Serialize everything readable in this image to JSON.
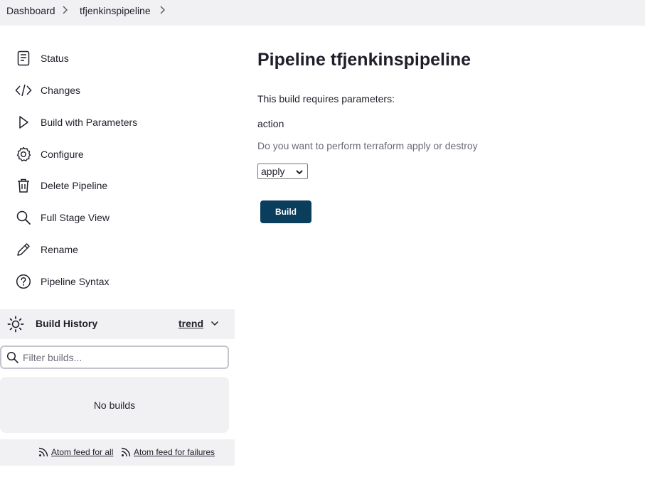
{
  "breadcrumb": {
    "items": [
      {
        "label": "Dashboard"
      },
      {
        "label": "tfjenkinspipeline"
      }
    ]
  },
  "sidebar": {
    "items": [
      {
        "label": "Status",
        "icon": "document-icon"
      },
      {
        "label": "Changes",
        "icon": "code-icon"
      },
      {
        "label": "Build with Parameters",
        "icon": "play-icon"
      },
      {
        "label": "Configure",
        "icon": "gear-icon"
      },
      {
        "label": "Delete Pipeline",
        "icon": "trash-icon"
      },
      {
        "label": "Full Stage View",
        "icon": "search-icon"
      },
      {
        "label": "Rename",
        "icon": "pencil-icon"
      },
      {
        "label": "Pipeline Syntax",
        "icon": "help-icon"
      }
    ]
  },
  "build_history": {
    "title": "Build History",
    "trend_label": "trend",
    "filter_placeholder": "Filter builds...",
    "empty_text": "No builds",
    "feeds": {
      "all": "Atom feed for all",
      "failures": "Atom feed for failures"
    }
  },
  "main": {
    "title": "Pipeline tfjenkinspipeline",
    "params_intro": "This build requires parameters:",
    "parameter": {
      "name": "action",
      "description": "Do you want to perform terraform apply or destroy",
      "selected": "apply"
    },
    "build_button": "Build"
  },
  "colors": {
    "accent": "#0b3d5c",
    "panel": "#f1f1f4",
    "muted_text": "#6b6b78"
  }
}
